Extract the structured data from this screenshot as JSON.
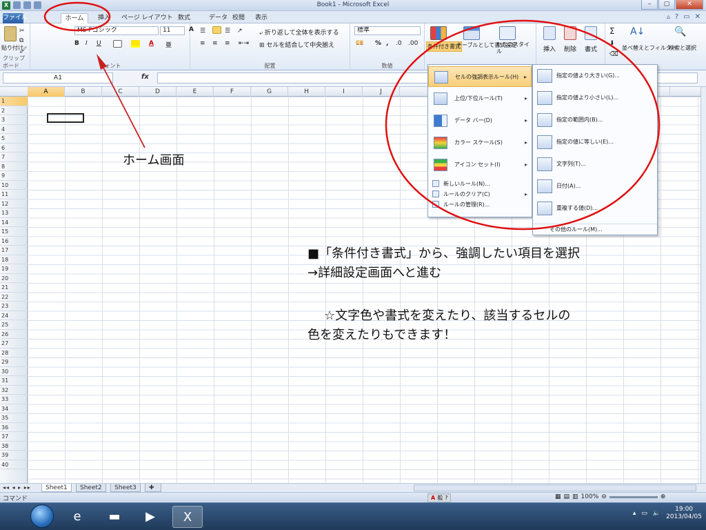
{
  "window": {
    "title": "Book1 - Microsoft Excel",
    "minimize": "–",
    "maximize": "▢",
    "close": "✕"
  },
  "tabs": [
    {
      "label": "ファイル"
    },
    {
      "label": "ホーム"
    },
    {
      "label": "挿入"
    },
    {
      "label": "ページ レイアウト"
    },
    {
      "label": "数式"
    },
    {
      "label": "データ"
    },
    {
      "label": "校閲"
    },
    {
      "label": "表示"
    }
  ],
  "ribbon": {
    "clipboard": {
      "paste": "貼り付け",
      "label": "クリップボード"
    },
    "font": {
      "name": "MS Pゴシック",
      "size": "11",
      "bold": "B",
      "italic": "I",
      "underline": "U",
      "label": "フォント"
    },
    "alignment": {
      "wrap": "折り返して全体を表示する",
      "merge": "セルを結合して中央揃え",
      "label": "配置"
    },
    "number": {
      "format": "標準",
      "label": "数値"
    },
    "styles": {
      "conditional": "条件付き書式",
      "table": "テーブルとして書式設定",
      "cell": "セルのスタイル"
    },
    "cells": {
      "insert": "挿入",
      "delete": "削除",
      "format": "書式"
    },
    "editing": {
      "sort": "並べ替えとフィルター",
      "find": "検索と選択"
    }
  },
  "formula": {
    "namebox": "A1",
    "fx": "fx"
  },
  "columns": [
    "A",
    "B",
    "C",
    "D",
    "E",
    "F",
    "G",
    "H",
    "I",
    "J",
    "Q"
  ],
  "rows": [
    "1",
    "2",
    "3",
    "4",
    "5",
    "6",
    "7",
    "8",
    "9",
    "10",
    "11",
    "12",
    "13",
    "14",
    "15",
    "16",
    "17",
    "18",
    "19",
    "20",
    "21",
    "22",
    "23",
    "24",
    "25",
    "26",
    "27",
    "28",
    "29",
    "30",
    "31",
    "32",
    "33",
    "34",
    "35",
    "36",
    "37",
    "38",
    "39",
    "40"
  ],
  "menu1": [
    {
      "label": "セルの強調表示ルール(H)",
      "submenu": true
    },
    {
      "label": "上位/下位ルール(T)",
      "submenu": true
    },
    {
      "label": "データ バー(D)",
      "submenu": true
    },
    {
      "label": "カラー スケール(S)",
      "submenu": true
    },
    {
      "label": "アイコン セット(I)",
      "submenu": true
    }
  ],
  "menu1_small": [
    {
      "label": "新しいルール(N)..."
    },
    {
      "label": "ルールのクリア(C)"
    },
    {
      "label": "ルールの管理(R)..."
    }
  ],
  "menu2": [
    {
      "label": "指定の値より大きい(G)..."
    },
    {
      "label": "指定の値より小さい(L)..."
    },
    {
      "label": "指定の範囲内(B)..."
    },
    {
      "label": "指定の値に等しい(E)..."
    },
    {
      "label": "文字列(T)..."
    },
    {
      "label": "日付(A)..."
    },
    {
      "label": "重複する値(D)..."
    }
  ],
  "menu2_more": "その他のルール(M)...",
  "annotations": {
    "home_label": "ホーム画面",
    "note1_line1": "■「条件付き書式」から、強調したい項目を選択",
    "note1_line2": "→詳細設定画面へと進む",
    "note2_line1": "☆文字色や書式を変えたり、該当するセルの",
    "note2_line2": "色を変えたりもできます！"
  },
  "sheets": [
    "Sheet1",
    "Sheet2",
    "Sheet3"
  ],
  "status": {
    "mode": "コマンド",
    "zoom": "100%"
  },
  "taskbar": {
    "time": "19:00",
    "date": "2013/04/05"
  },
  "colors": {
    "annotation_red": "#e01010",
    "highlight": "#f8cf78",
    "ribbon_blue": "#dfe8f5"
  }
}
